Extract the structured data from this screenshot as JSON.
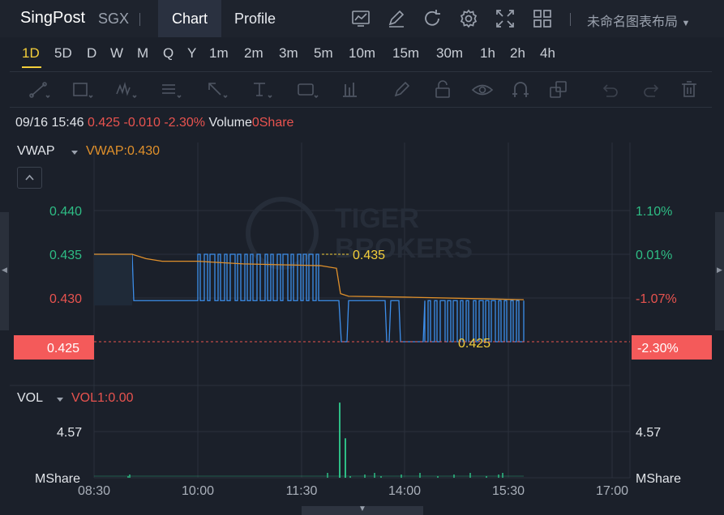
{
  "header": {
    "brand": "SingPost",
    "exchange": "SGX",
    "tabs": [
      "Chart",
      "Profile"
    ],
    "layout_label": "未命名图表布局"
  },
  "toolbar_icons": [
    "chart-type-icon",
    "edit-icon",
    "refresh-icon",
    "settings-icon",
    "fullscreen-icon",
    "grid-layout-icon"
  ],
  "periods": [
    "1D",
    "5D",
    "D",
    "W",
    "M",
    "Q",
    "Y",
    "1m",
    "2m",
    "3m",
    "5m",
    "10m",
    "15m",
    "30m",
    "1h",
    "2h",
    "4h"
  ],
  "active_period": "1D",
  "drawing_tools": [
    "trend-line-icon",
    "rectangle-icon",
    "wave-icon",
    "fib-icon",
    "arrow-icon",
    "text-icon",
    "label-icon",
    "bars-icon",
    "pen-icon",
    "lock-icon",
    "eye-icon",
    "magnet-icon",
    "copy-icon",
    "undo-icon",
    "redo-icon",
    "trash-icon"
  ],
  "info": {
    "datetime": "09/16 15:46",
    "price": "0.425",
    "change": "-0.010",
    "change_pct": "-2.30%",
    "volume_label": "Volume",
    "volume_value": "0Share"
  },
  "indicators": {
    "main_name": "VWAP",
    "main_value": "VWAP:0.430",
    "sub_name": "VOL",
    "sub_value": "VOL1:0.00"
  },
  "watermark": "TIGER BROKERS",
  "colors": {
    "up": "#2ebd85",
    "down": "#e8534f",
    "price_line": "#3d8eea",
    "vwap_line": "#e0902b",
    "marker": "#f4cf3a",
    "current_price_bg": "#f45a5a"
  },
  "chart_data": {
    "type": "line",
    "x_ticks": [
      "08:30",
      "10:00",
      "11:30",
      "14:00",
      "15:30",
      "17:00"
    ],
    "y_ticks_left": [
      "0.440",
      "0.435",
      "0.430"
    ],
    "y_ticks_right": [
      "1.10%",
      "0.01%",
      "-1.07%"
    ],
    "ylim": [
      0.4245,
      0.4425
    ],
    "current_price": {
      "left": "0.425",
      "right": "-2.30%"
    },
    "high_marker": "0.435",
    "low_marker": "0.425",
    "volume_ticks": [
      "4.57",
      "MShare"
    ],
    "volume_ticks_right": [
      "4.57",
      "MShare"
    ],
    "series": [
      {
        "name": "Price",
        "segments": [
          {
            "from": "09:00",
            "to": "09:20",
            "value": 0.435
          },
          {
            "from": "09:20",
            "to": "10:00",
            "value": 0.4297
          },
          {
            "from": "10:00",
            "to": "11:40",
            "value": "oscillating 0.4297-0.435"
          },
          {
            "from": "11:40",
            "to": "12:00",
            "value": 0.4297
          },
          {
            "from": "12:00",
            "to": "13:40",
            "value": "oscillating 0.425-0.4297"
          },
          {
            "from": "13:40",
            "to": "15:40",
            "value": "oscillating 0.425-0.4297"
          }
        ]
      },
      {
        "name": "VWAP",
        "points": [
          [
            0,
            0.435
          ],
          [
            0.2,
            0.4345
          ],
          [
            0.4,
            0.4342
          ],
          [
            0.53,
            0.4338
          ],
          [
            0.56,
            0.4305
          ],
          [
            0.8,
            0.43
          ],
          [
            1.0,
            0.4297
          ]
        ]
      }
    ],
    "volume_spikes": [
      {
        "time": "12:20",
        "value": 8.0
      },
      {
        "time": "12:25",
        "value": 4.2
      }
    ]
  }
}
